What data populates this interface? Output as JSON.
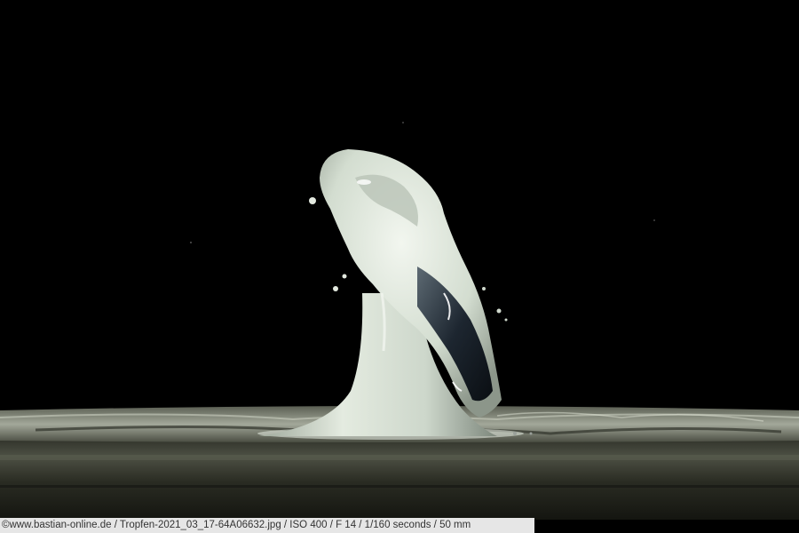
{
  "photo": {
    "subject": "milk-drop-splash",
    "colors": {
      "background": "#000000",
      "liquid": "#d9e3d6",
      "liquid_shadow": "#7e8a80",
      "water_surface": "#9aa093",
      "tray_rim": "#3c3f33"
    }
  },
  "caption": {
    "text": "©www.bastian-online.de / Tropfen-2021_03_17-64A06632.jpg / ISO 400 / F 14 / 1/160 seconds  / 50 mm"
  }
}
